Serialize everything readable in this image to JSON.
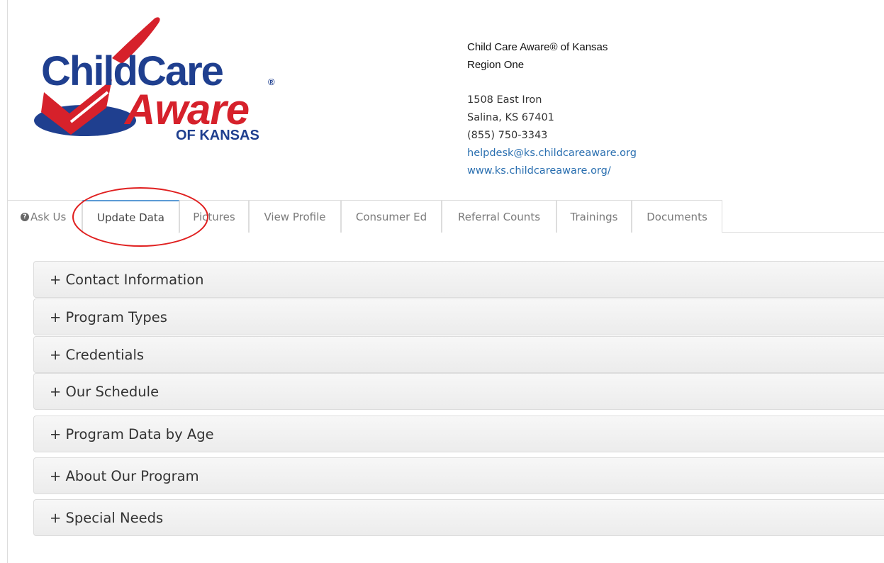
{
  "logo": {
    "line1": "ChildCare",
    "line2": "Aware",
    "line3": "OF KANSAS",
    "registered": "®",
    "colors": {
      "blue": "#1f3f8f",
      "red": "#d6212b"
    }
  },
  "contact": {
    "org_name": "Child Care Aware® of Kansas",
    "region": "Region One",
    "street": "1508 East Iron",
    "city": "Salina, KS 67401",
    "phone": "(855) 750-3343",
    "email": "helpdesk@ks.childcareaware.org",
    "website": "www.ks.childcareaware.org/"
  },
  "tabs": [
    {
      "label": "Ask Us",
      "icon": "question-circle-icon"
    },
    {
      "label": "Update Data",
      "active": true
    },
    {
      "label": "Pictures"
    },
    {
      "label": "View Profile"
    },
    {
      "label": "Consumer Ed"
    },
    {
      "label": "Referral Counts"
    },
    {
      "label": "Trainings"
    },
    {
      "label": "Documents"
    }
  ],
  "accordion": [
    {
      "label": "+ Contact Information"
    },
    {
      "label": "+ Program Types"
    },
    {
      "label": "+ Credentials"
    },
    {
      "label": "+ Our Schedule"
    },
    {
      "label": "+ Program Data by Age"
    },
    {
      "label": "+ About Our Program"
    },
    {
      "label": "+ Special Needs"
    }
  ],
  "colors": {
    "link": "#2a6fb0",
    "annotation": "#e02020",
    "active_tab_top": "#5b9bd5"
  }
}
